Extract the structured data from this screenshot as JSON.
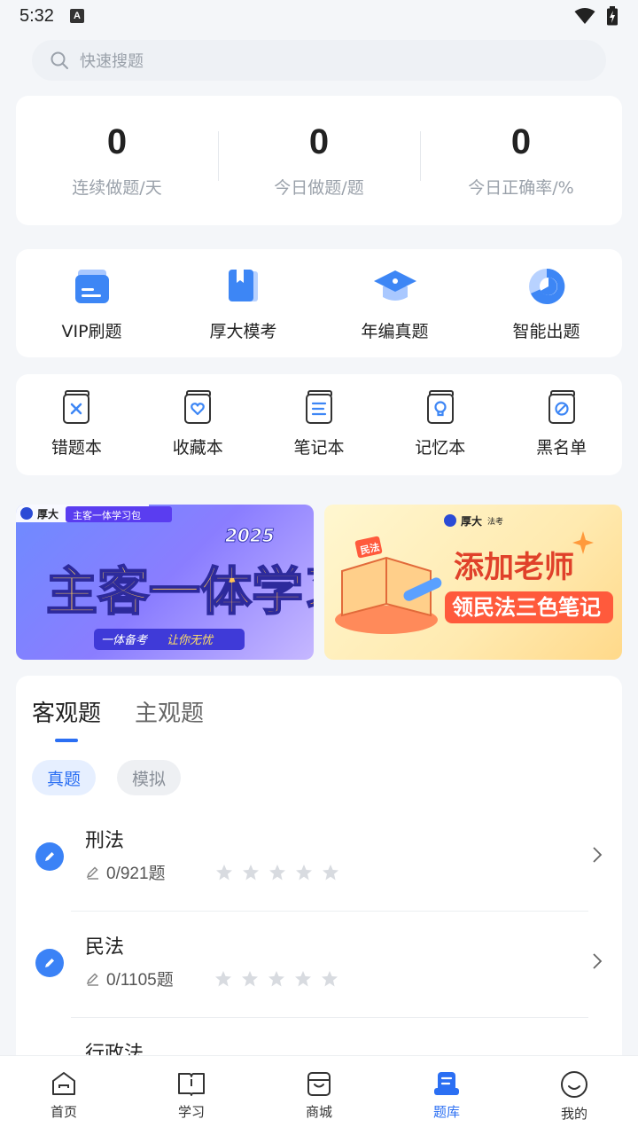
{
  "status": {
    "time": "5:32",
    "notif_letter": "A"
  },
  "search": {
    "placeholder": "快速搜题"
  },
  "stats": [
    {
      "value": "0",
      "label": "连续做题/天"
    },
    {
      "value": "0",
      "label": "今日做题/题"
    },
    {
      "value": "0",
      "label": "今日正确率/%"
    }
  ],
  "features": [
    {
      "label": "VIP刷题",
      "icon": "folder-icon"
    },
    {
      "label": "厚大模考",
      "icon": "book-icon"
    },
    {
      "label": "年编真题",
      "icon": "graduation-cap-icon"
    },
    {
      "label": "智能出题",
      "icon": "pie-chart-icon"
    }
  ],
  "tools": [
    {
      "label": "错题本",
      "icon": "wrong-notebook-icon"
    },
    {
      "label": "收藏本",
      "icon": "favorite-notebook-icon"
    },
    {
      "label": "笔记本",
      "icon": "notebook-icon"
    },
    {
      "label": "记忆本",
      "icon": "memory-notebook-icon"
    },
    {
      "label": "黑名单",
      "icon": "blacklist-icon"
    }
  ],
  "banners": {
    "left": {
      "brand": "厚大",
      "tag": "主客一体学习包",
      "headline": "主客一体学习包",
      "year": "2025",
      "slogan_1": "一体备考",
      "slogan_2": "让你无忧"
    },
    "right": {
      "brand": "厚大",
      "brand_sub": "法考",
      "badge": "民法",
      "headline": "添加老师",
      "subline": "领民法三色笔记"
    }
  },
  "qbank": {
    "tabs": [
      {
        "label": "客观题",
        "active": true
      },
      {
        "label": "主观题",
        "active": false
      }
    ],
    "pills": [
      {
        "label": "真题",
        "active": true
      },
      {
        "label": "模拟",
        "active": false
      }
    ],
    "subjects": [
      {
        "name": "刑法",
        "count": "0/921题",
        "stars": 0
      },
      {
        "name": "民法",
        "count": "0/1105题",
        "stars": 0
      },
      {
        "name": "行政法",
        "count": "",
        "stars": 0
      }
    ]
  },
  "tabbar": [
    {
      "label": "首页",
      "icon": "home-icon",
      "active": false
    },
    {
      "label": "学习",
      "icon": "study-book-icon",
      "active": false
    },
    {
      "label": "商城",
      "icon": "shop-icon",
      "active": false
    },
    {
      "label": "题库",
      "icon": "question-bank-icon",
      "active": true
    },
    {
      "label": "我的",
      "icon": "profile-smile-icon",
      "active": false
    }
  ],
  "colors": {
    "accent": "#2b6ff3",
    "background": "#f4f6f9",
    "star_empty": "#d8dbe0"
  }
}
